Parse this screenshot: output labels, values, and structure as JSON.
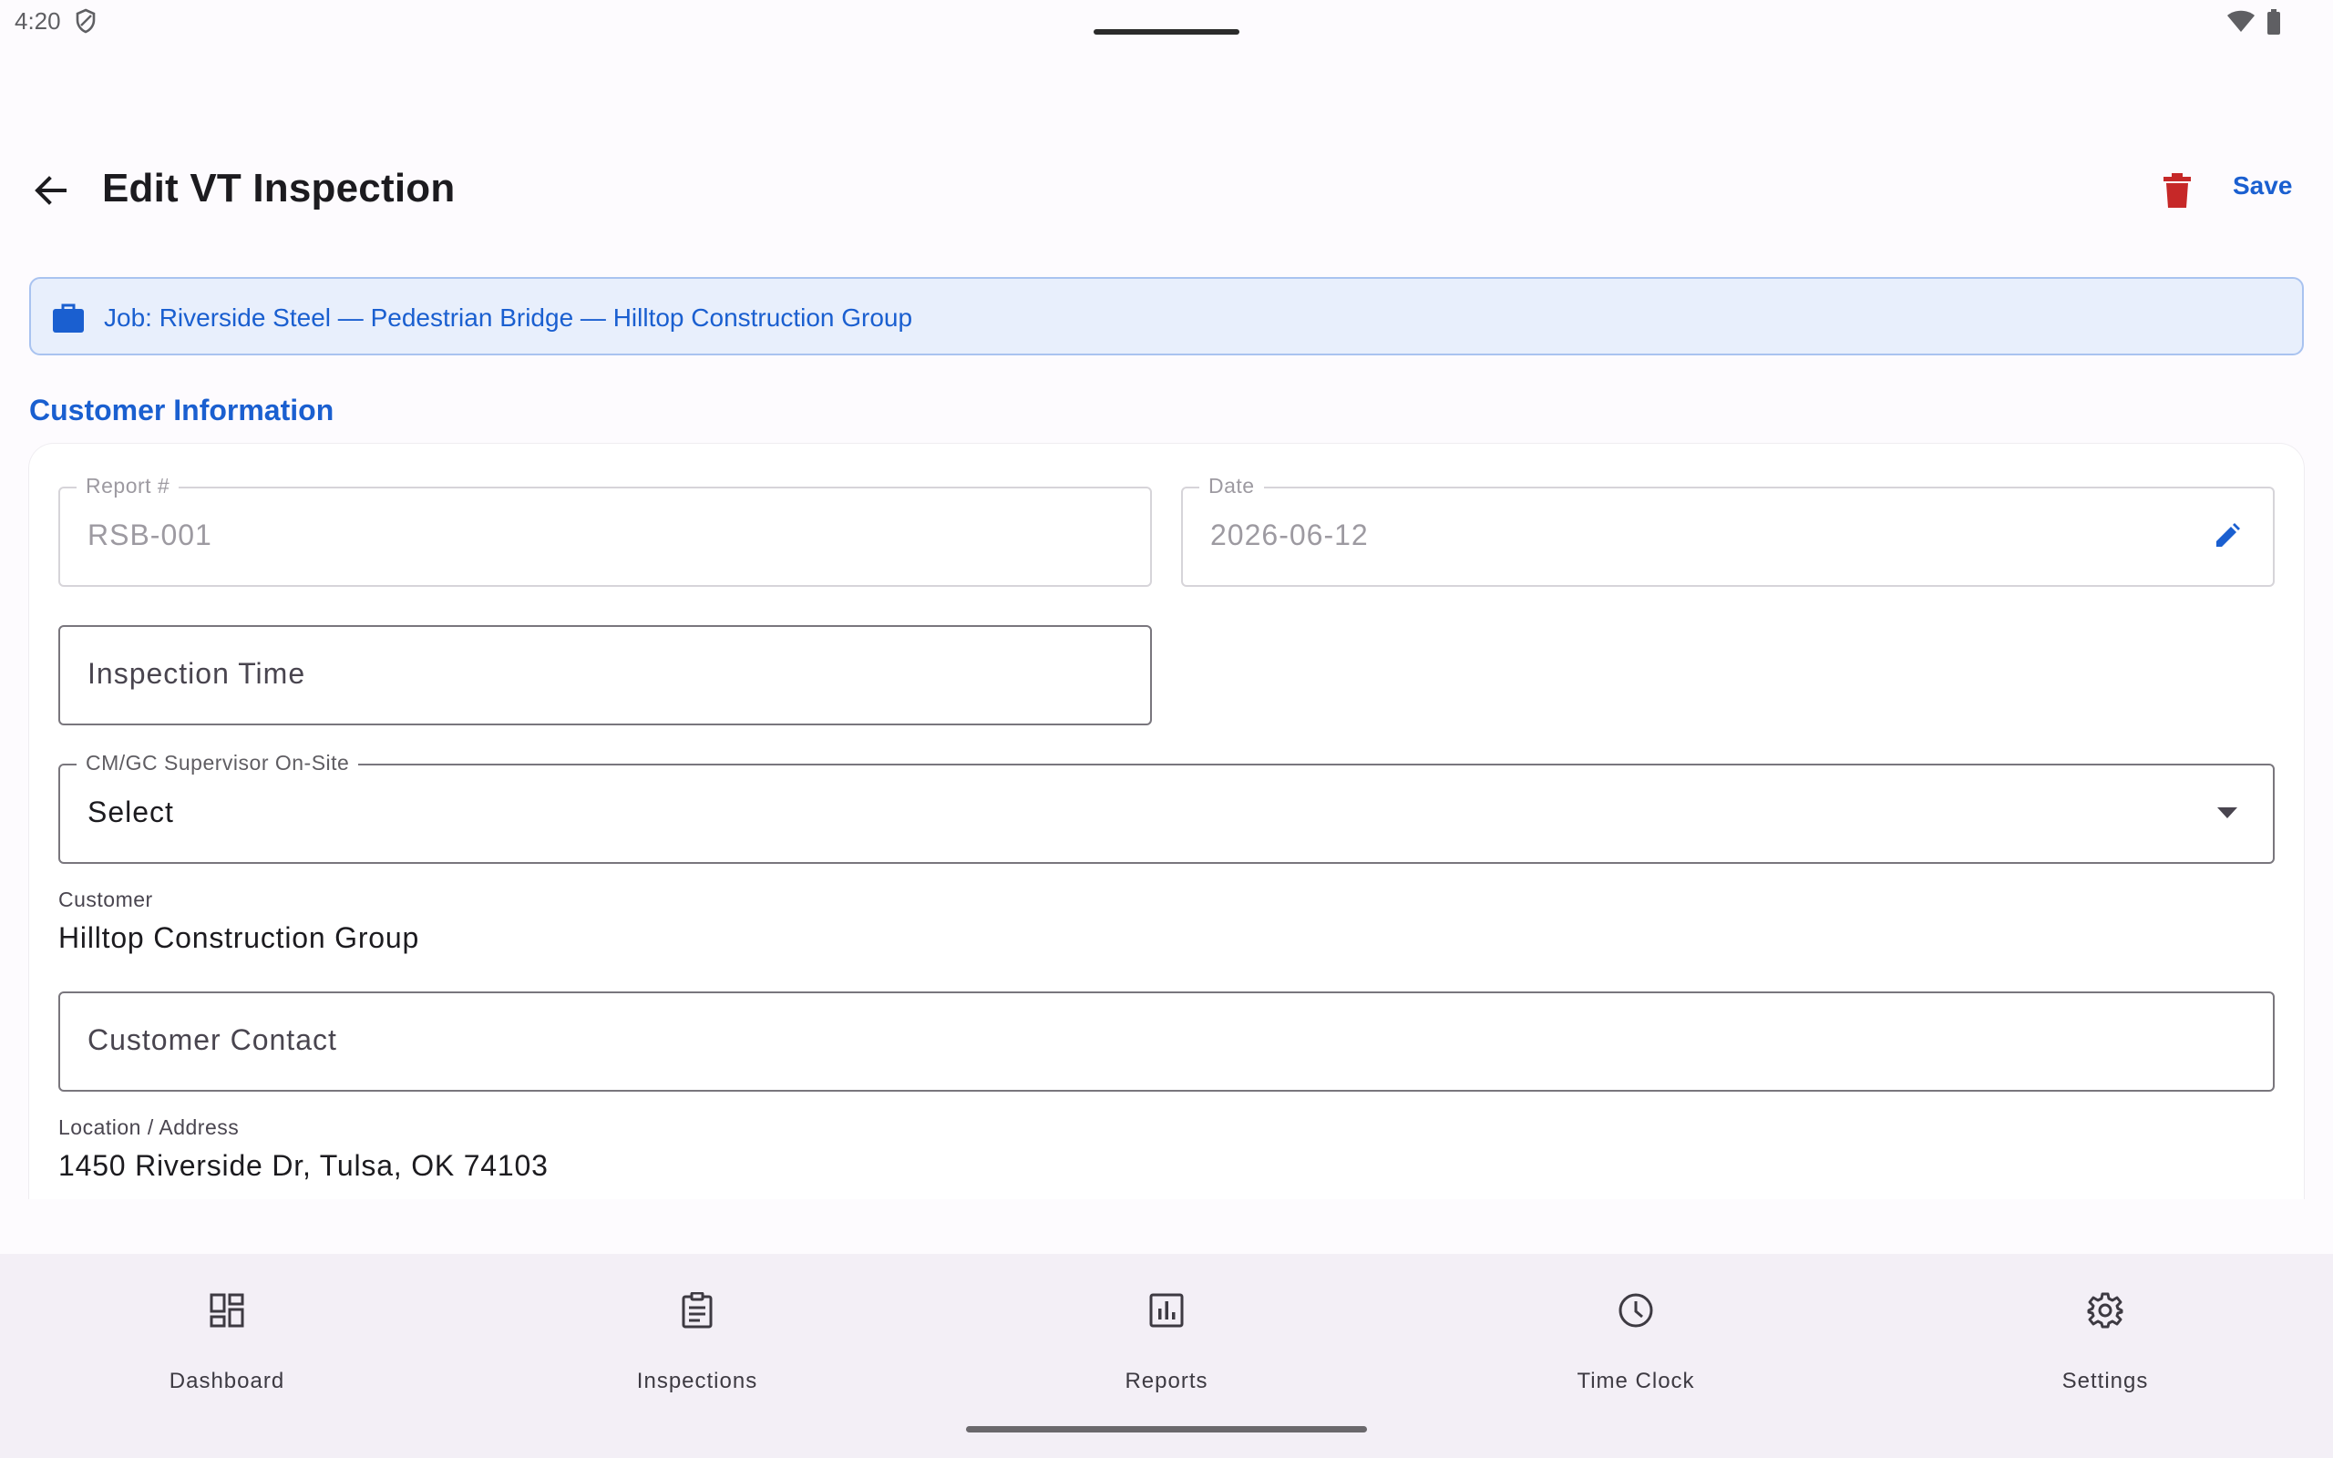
{
  "status_bar": {
    "time": "4:20"
  },
  "app_bar": {
    "title": "Edit VT Inspection",
    "save_label": "Save"
  },
  "job_banner": {
    "text": "Job: Riverside Steel — Pedestrian Bridge — Hilltop Construction Group"
  },
  "section": {
    "title": "Customer Information"
  },
  "form": {
    "report_number": {
      "label": "Report #",
      "value": "RSB-001"
    },
    "date": {
      "label": "Date",
      "value": "2026-06-12"
    },
    "inspection_time": {
      "placeholder": "Inspection Time"
    },
    "supervisor": {
      "label": "CM/GC Supervisor On-Site",
      "value": "Select"
    },
    "customer": {
      "label": "Customer",
      "value": "Hilltop Construction Group"
    },
    "customer_contact": {
      "placeholder": "Customer Contact"
    },
    "location": {
      "label": "Location / Address",
      "value": "1450 Riverside Dr, Tulsa, OK 74103"
    }
  },
  "bottom_nav": {
    "items": [
      {
        "label": "Dashboard",
        "icon": "dashboard-icon"
      },
      {
        "label": "Inspections",
        "icon": "clipboard-icon"
      },
      {
        "label": "Reports",
        "icon": "bar-chart-icon"
      },
      {
        "label": "Time Clock",
        "icon": "clock-icon"
      },
      {
        "label": "Settings",
        "icon": "gear-icon"
      }
    ]
  },
  "colors": {
    "accent": "#1a5fd0",
    "delete": "#c62828",
    "banner_bg": "#e8effc",
    "nav_bg": "#f3eff6"
  }
}
